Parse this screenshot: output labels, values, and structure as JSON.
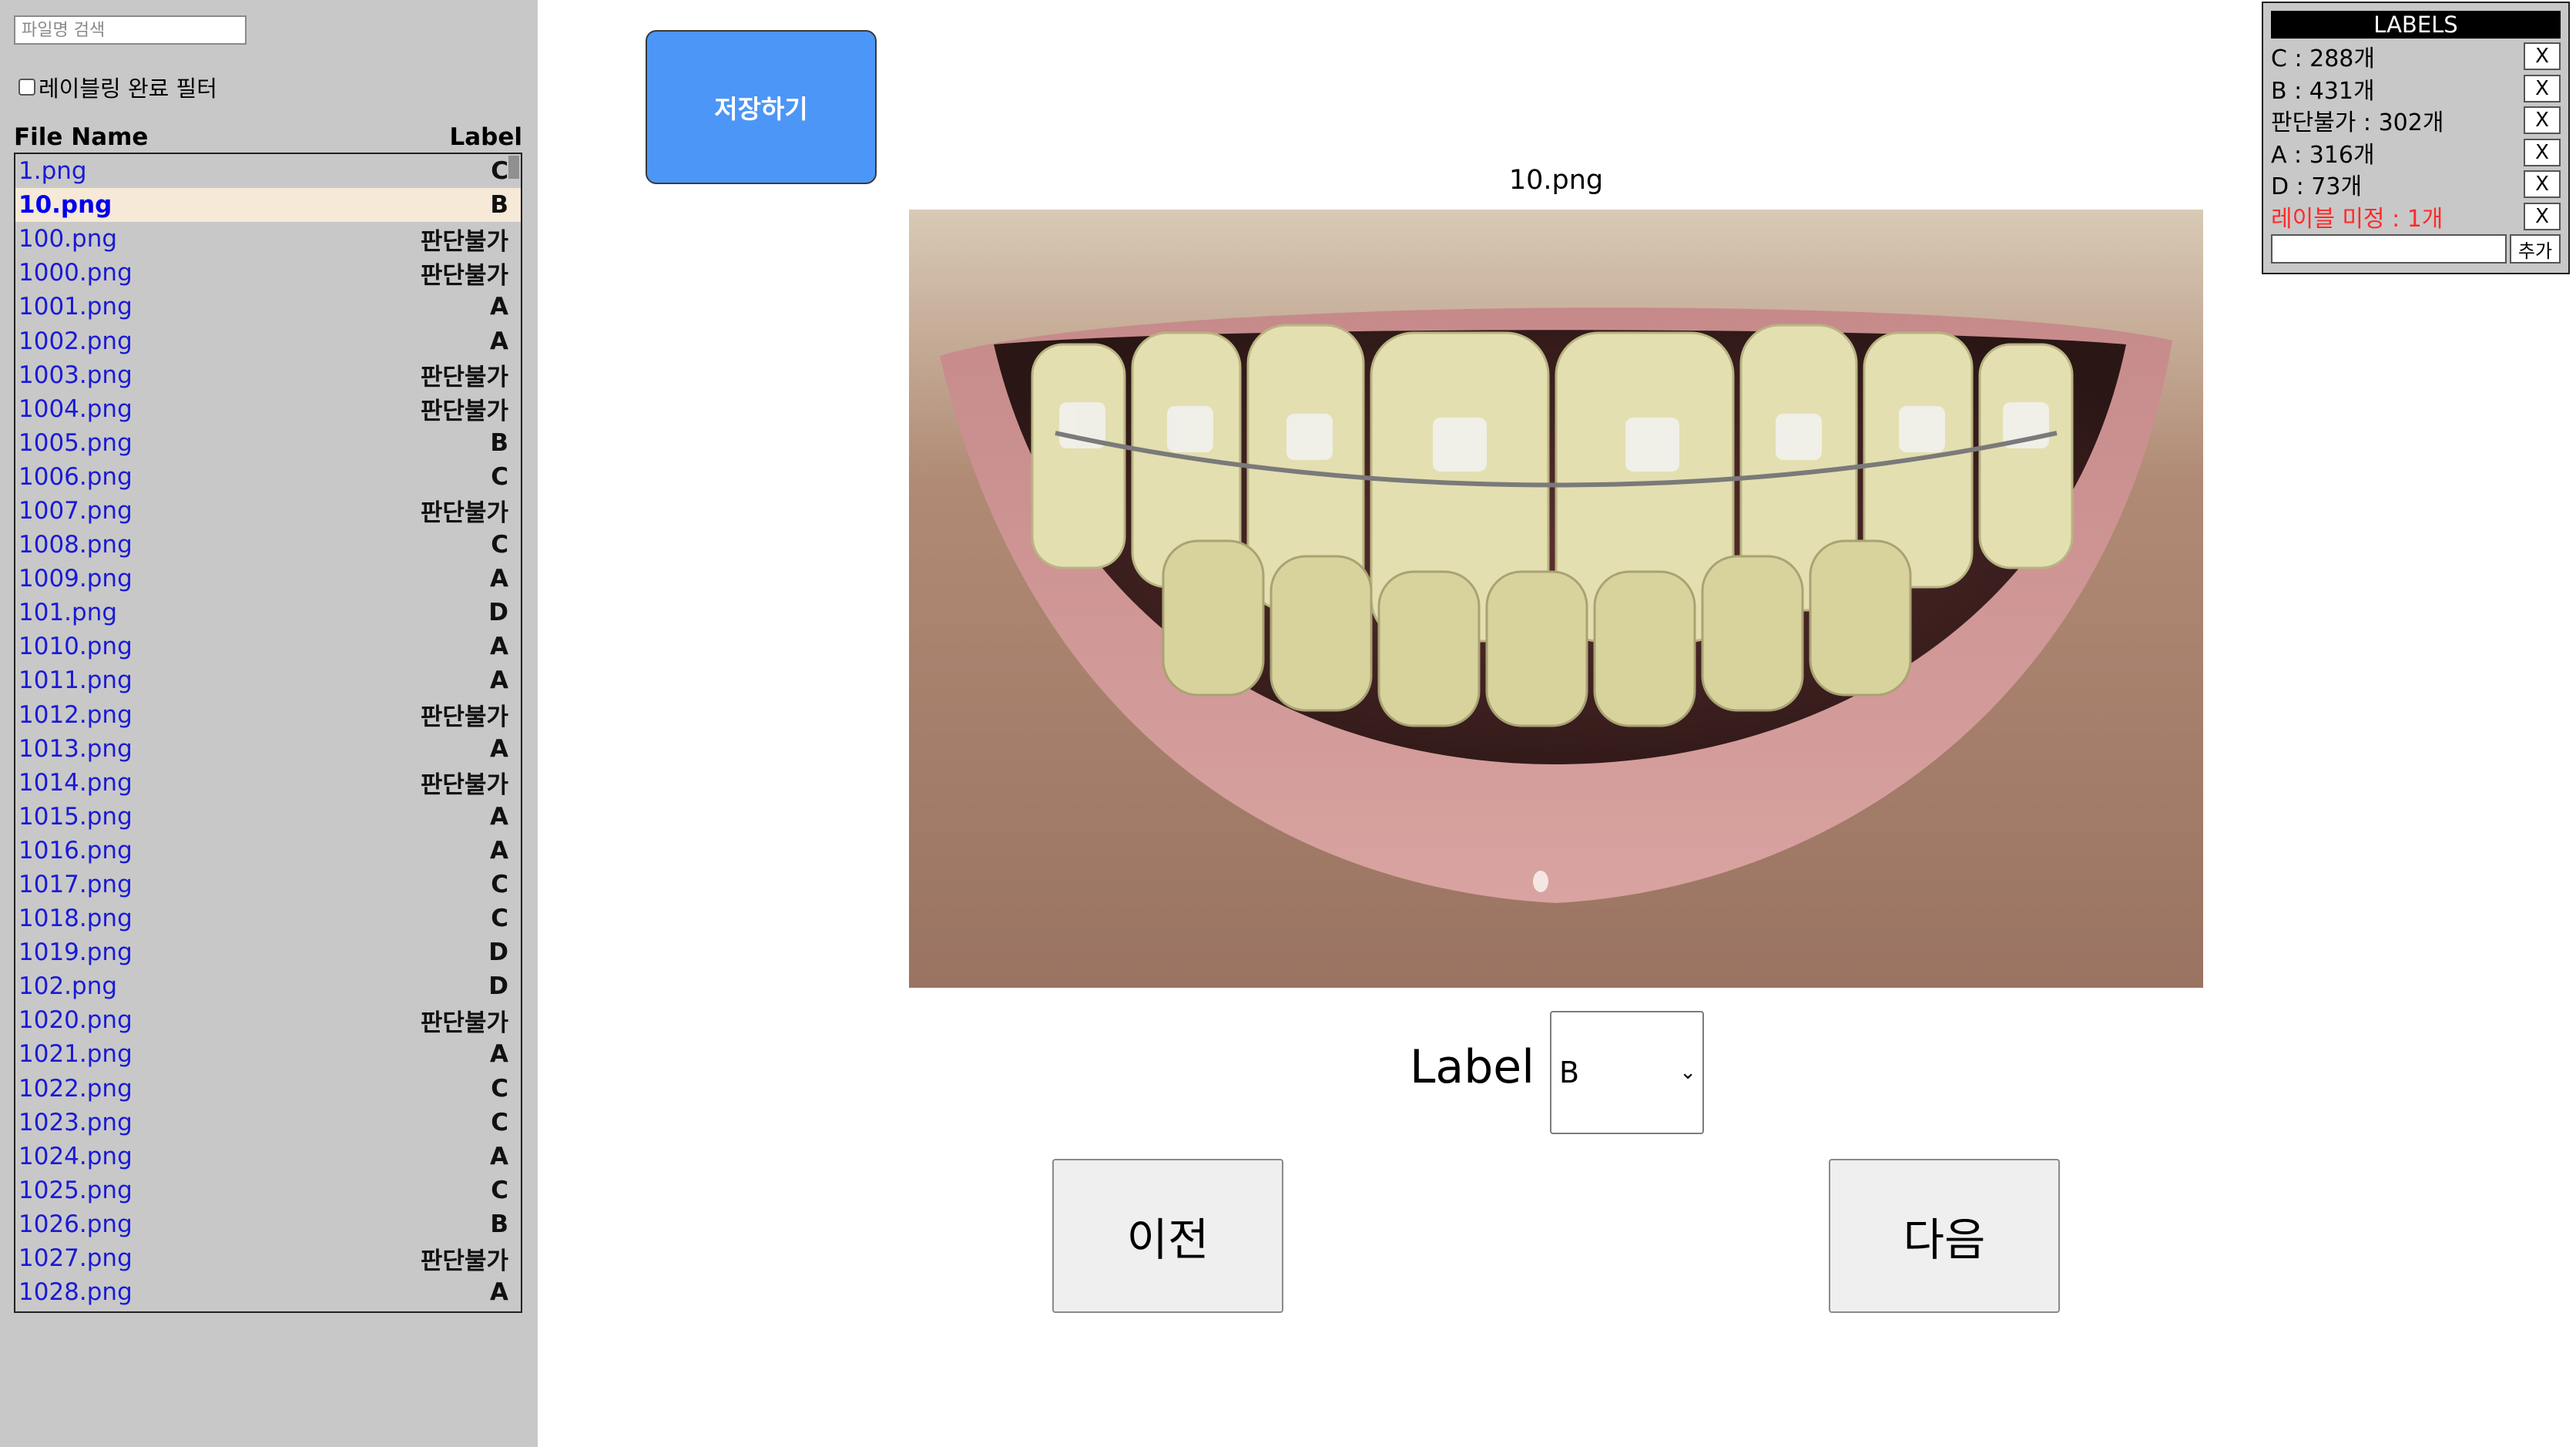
{
  "sidebar": {
    "search_placeholder": "파일명 검색",
    "filter_label": "레이블링 완료 필터",
    "header_filename": "File Name",
    "header_label": "Label",
    "files": [
      {
        "name": "1.png",
        "label": "C"
      },
      {
        "name": "10.png",
        "label": "B",
        "selected": true
      },
      {
        "name": "100.png",
        "label": "판단불가"
      },
      {
        "name": "1000.png",
        "label": "판단불가"
      },
      {
        "name": "1001.png",
        "label": "A"
      },
      {
        "name": "1002.png",
        "label": "A"
      },
      {
        "name": "1003.png",
        "label": "판단불가"
      },
      {
        "name": "1004.png",
        "label": "판단불가"
      },
      {
        "name": "1005.png",
        "label": "B"
      },
      {
        "name": "1006.png",
        "label": "C"
      },
      {
        "name": "1007.png",
        "label": "판단불가"
      },
      {
        "name": "1008.png",
        "label": "C"
      },
      {
        "name": "1009.png",
        "label": "A"
      },
      {
        "name": "101.png",
        "label": "D"
      },
      {
        "name": "1010.png",
        "label": "A"
      },
      {
        "name": "1011.png",
        "label": "A"
      },
      {
        "name": "1012.png",
        "label": "판단불가"
      },
      {
        "name": "1013.png",
        "label": "A"
      },
      {
        "name": "1014.png",
        "label": "판단불가"
      },
      {
        "name": "1015.png",
        "label": "A"
      },
      {
        "name": "1016.png",
        "label": "A"
      },
      {
        "name": "1017.png",
        "label": "C"
      },
      {
        "name": "1018.png",
        "label": "C"
      },
      {
        "name": "1019.png",
        "label": "D"
      },
      {
        "name": "102.png",
        "label": "D"
      },
      {
        "name": "1020.png",
        "label": "판단불가"
      },
      {
        "name": "1021.png",
        "label": "A"
      },
      {
        "name": "1022.png",
        "label": "C"
      },
      {
        "name": "1023.png",
        "label": "C"
      },
      {
        "name": "1024.png",
        "label": "A"
      },
      {
        "name": "1025.png",
        "label": "C"
      },
      {
        "name": "1026.png",
        "label": "B"
      },
      {
        "name": "1027.png",
        "label": "판단불가"
      },
      {
        "name": "1028.png",
        "label": "A"
      }
    ]
  },
  "main": {
    "save_label": "저장하기",
    "image_title": "10.png",
    "label_caption": "Label",
    "selected_label": "B",
    "prev_label": "이전",
    "next_label": "다음"
  },
  "labels_panel": {
    "title": "LABELS",
    "items": [
      {
        "text": "C : 288개",
        "remove": "X"
      },
      {
        "text": "B : 431개",
        "remove": "X"
      },
      {
        "text": "판단불가 : 302개",
        "remove": "X"
      },
      {
        "text": "A : 316개",
        "remove": "X"
      },
      {
        "text": "D : 73개",
        "remove": "X"
      },
      {
        "text": "레이블 미정 : 1개",
        "remove": "X",
        "pending": true
      }
    ],
    "add_label": "추가"
  },
  "colors": {
    "sidebar_bg": "#c8c8c8",
    "save_button": "#4c96f7",
    "link_blue": "#1a1ad6",
    "selected_row": "#f6e9d8",
    "pending_red": "#ff2a2a"
  }
}
